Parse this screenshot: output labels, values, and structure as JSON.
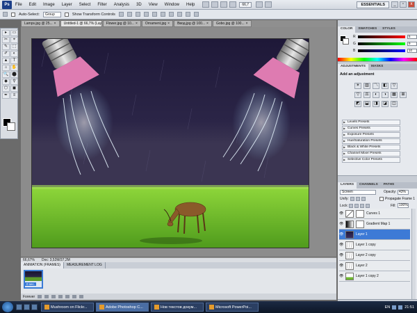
{
  "app": {
    "logo": "Ps",
    "menu": [
      "File",
      "Edit",
      "Image",
      "Layer",
      "Select",
      "Filter",
      "Analysis",
      "3D",
      "View",
      "Window",
      "Help"
    ],
    "zoom": "66,7",
    "workspace": "ESSENTIALS",
    "win_buttons": [
      "_",
      "▫",
      "x"
    ]
  },
  "options": {
    "auto_select_label": "Auto-Select:",
    "auto_select_value": "Group",
    "transform_label": "Show Transform Controls"
  },
  "doc_tabs": [
    {
      "label": "Lamps.jpg @ 25...",
      "active": false
    },
    {
      "label": "Untitled-1 @ 66,7% (Layer 1, RGB/8/CMYK) *",
      "active": true
    },
    {
      "label": "Flower.jpg @ 10...",
      "active": false
    },
    {
      "label": "Ornament.jpg",
      "active": false
    },
    {
      "label": "Ввод.jpg @ 100...",
      "active": false
    },
    {
      "label": "Gobo.jpg @ 100...",
      "active": false
    }
  ],
  "tools": [
    "▸",
    "▭",
    "✂",
    "⌖",
    "✎",
    "⬚",
    "✐",
    "◐",
    "▲",
    "T",
    "⌂",
    "✋",
    "🔍",
    "⬤",
    "◆",
    "⚲",
    "⬡",
    "◼",
    "✒",
    "≡"
  ],
  "status": {
    "zoom": "66,67%",
    "doc": "Doc: 3,52M/37,2M"
  },
  "animation": {
    "tabs": [
      {
        "label": "ANIMATION (FRAMES)",
        "active": true
      },
      {
        "label": "MEASUREMENT LOG",
        "active": false
      }
    ],
    "frame_delay": "0 sec.",
    "loop": "Forever"
  },
  "color_panel": {
    "tabs": [
      {
        "label": "COLOR",
        "active": true
      },
      {
        "label": "SWATCHES",
        "active": false
      },
      {
        "label": "STYLES",
        "active": false
      }
    ],
    "channels": [
      {
        "label": "R",
        "value": "5",
        "gradient": "linear-gradient(90deg,#000,#f00)"
      },
      {
        "label": "G",
        "value": "9",
        "gradient": "linear-gradient(90deg,#000,#0f0)"
      },
      {
        "label": "B",
        "value": "10",
        "gradient": "linear-gradient(90deg,#000,#00f)"
      }
    ]
  },
  "adjustments": {
    "tabs": [
      {
        "label": "ADJUSTMENTS",
        "active": true
      },
      {
        "label": "MASKS",
        "active": false
      }
    ],
    "title": "Add an adjustment",
    "icons_row1": [
      "☀",
      "▥",
      "〽",
      "◧",
      "▽"
    ],
    "icons_row2": [
      "▽",
      "⚖",
      "◐",
      "◑",
      "▦",
      "⊞"
    ],
    "icons_row3": [
      "◩",
      "⬓",
      "◨",
      "◪",
      "◫"
    ],
    "presets": [
      "Levels Presets",
      "Curves Presets",
      "Exposure Presets",
      "Hue/Saturation Presets",
      "Black & White Presets",
      "Channel Mixer Presets",
      "Selective Color Presets"
    ]
  },
  "layers": {
    "tabs": [
      {
        "label": "LAYERS",
        "active": true
      },
      {
        "label": "CHANNELS",
        "active": false
      },
      {
        "label": "PATHS",
        "active": false
      }
    ],
    "blend_mode": "Screen",
    "opacity_label": "Opacity:",
    "opacity": "43%",
    "unify_label": "Unify:",
    "propagate_label": "Propagate Frame 1",
    "lock_label": "Lock:",
    "fill_label": "Fill:",
    "fill": "100%",
    "items": [
      {
        "name": "Curves 1",
        "selected": false,
        "thumb": "adj",
        "mask": true
      },
      {
        "name": "Gradient Map 1",
        "selected": false,
        "thumb": "grad",
        "mask": true
      },
      {
        "name": "Layer 1",
        "selected": true,
        "thumb": "dark",
        "mask": false
      },
      {
        "name": "Layer 1 copy",
        "selected": false,
        "thumb": "rain",
        "mask": false
      },
      {
        "name": "Layer 2 copy",
        "selected": false,
        "thumb": "rain",
        "mask": false
      },
      {
        "name": "Layer 2",
        "selected": false,
        "thumb": "rain",
        "mask": false
      },
      {
        "name": "Layer 1 copy 2",
        "selected": false,
        "thumb": "grass",
        "mask": false
      }
    ]
  },
  "taskbar": {
    "tasks": [
      {
        "label": "Mushroom on Flickr...",
        "active": false
      },
      {
        "label": "Adobe Photoshop C...",
        "active": true
      },
      {
        "label": "Нов текстов докум...",
        "active": false
      },
      {
        "label": "Microsoft PowerPoi...",
        "active": false
      }
    ],
    "lang": "EN",
    "clock": "21:51"
  }
}
